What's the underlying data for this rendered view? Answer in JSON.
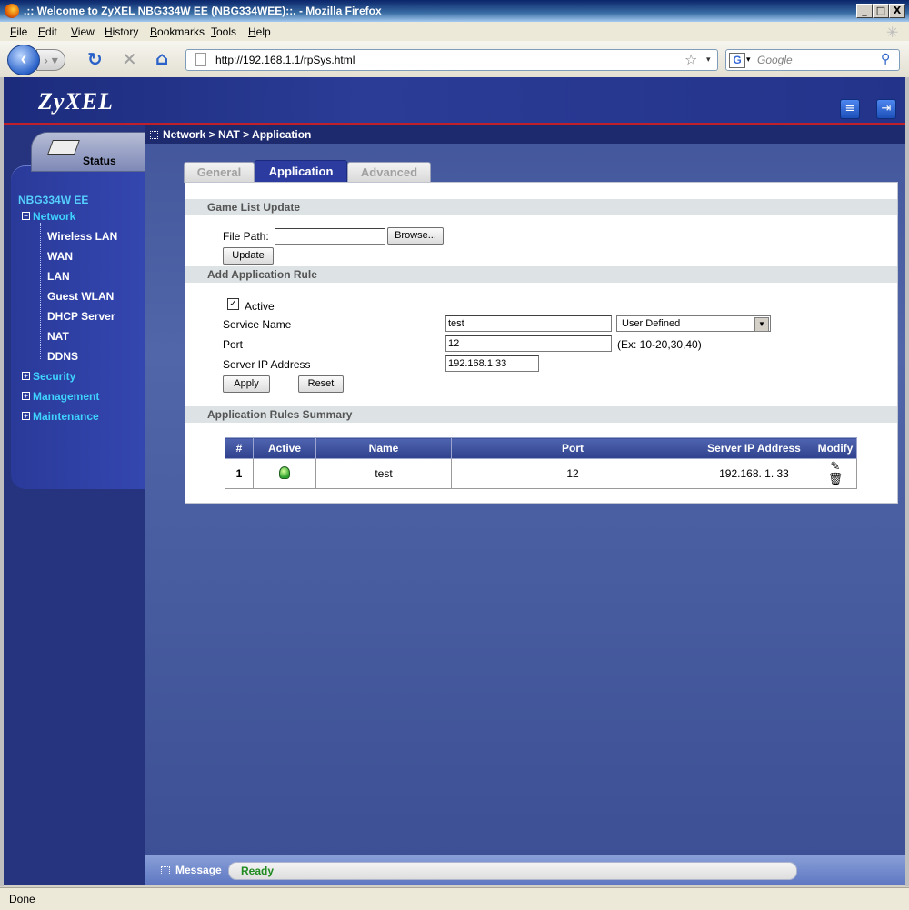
{
  "window": {
    "title": ".:: Welcome to ZyXEL NBG334W EE (NBG334WEE)::. - Mozilla Firefox",
    "controls": {
      "minimize": "_",
      "maximize": "□",
      "close": "X"
    }
  },
  "menubar": [
    "File",
    "Edit",
    "View",
    "History",
    "Bookmarks",
    "Tools",
    "Help"
  ],
  "toolbar": {
    "url": "http://192.168.1.1/rpSys.html",
    "search_placeholder": "Google",
    "search_engine_glyph": "G"
  },
  "header": {
    "logo": "ZyXEL"
  },
  "sidebar": {
    "status_label": "Status",
    "model": "NBG334W EE",
    "network": "Network",
    "network_children": [
      "Wireless LAN",
      "WAN",
      "LAN",
      "Guest WLAN",
      "DHCP Server",
      "NAT",
      "DDNS"
    ],
    "security": "Security",
    "management": "Management",
    "maintenance": "Maintenance",
    "expand_glyph": "+",
    "collapse_glyph": "−"
  },
  "breadcrumb": "Network > NAT > Application",
  "tabs": [
    "General",
    "Application",
    "Advanced"
  ],
  "active_tab": "Application",
  "game_list": {
    "title": "Game List Update",
    "file_path_label": "File Path:",
    "file_path_value": "",
    "browse_label": "Browse...",
    "update_label": "Update"
  },
  "app_rule": {
    "title": "Add Application Rule",
    "active_label": "Active",
    "active_checked": true,
    "service_name_label": "Service Name",
    "service_name_value": "test",
    "service_type": "User Defined",
    "port_label": "Port",
    "port_value": "12",
    "port_hint": "(Ex: 10-20,30,40)",
    "server_ip_label": "Server IP Address",
    "server_ip_value": "192.168.1.33",
    "apply_label": "Apply",
    "reset_label": "Reset"
  },
  "summary": {
    "title": "Application Rules Summary",
    "columns": [
      "#",
      "Active",
      "Name",
      "Port",
      "Server IP Address",
      "Modify"
    ],
    "rows": [
      {
        "index": "1",
        "active": true,
        "name": "test",
        "port": "12",
        "server_ip": "192.168. 1. 33"
      }
    ]
  },
  "message": {
    "label": "Message",
    "text": "Ready"
  },
  "statusbar": "Done"
}
